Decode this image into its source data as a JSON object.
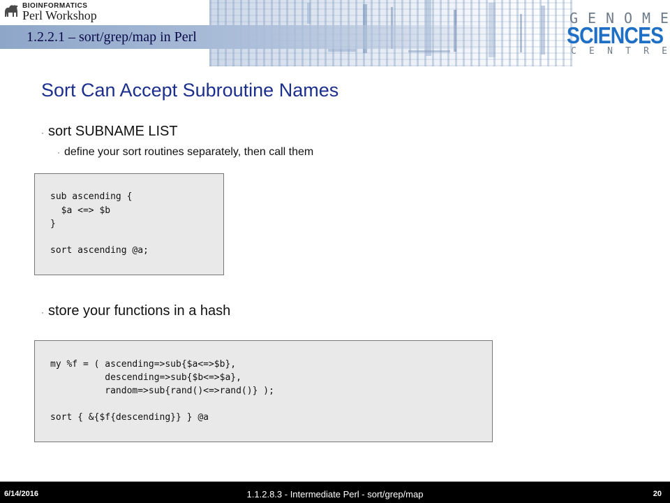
{
  "header": {
    "logo_small": "BIOINFORMATICS",
    "logo_big": "Perl Workshop",
    "lecture_title": "1.2.2.1 – sort/grep/map in Perl",
    "genome_letters": [
      "G",
      "E",
      "N",
      "O",
      "M",
      "E"
    ],
    "sciences": "SCIENCES",
    "centre_letters": [
      "C",
      "E",
      "N",
      "T",
      "R",
      "E"
    ]
  },
  "slide": {
    "title": "Sort Can Accept Subroutine Names",
    "bullet1": "sort SUBNAME LIST",
    "bullet2": "define your sort routines separately, then call them",
    "code1": [
      "sub ascending {",
      "  $a <=> $b",
      "}",
      "",
      "sort ascending @a;"
    ],
    "bullet3": "store your functions in a hash",
    "code2": [
      "my %f = ( ascending=>sub{$a<=>$b},",
      "          descending=>sub{$b<=>$a},",
      "          random=>sub{rand()<=>rand()} );",
      "",
      "sort { &{$f{descending}} } @a"
    ]
  },
  "footer": {
    "date": "6/14/2016",
    "center": "1.1.2.8.3 - Intermediate Perl - sort/grep/map",
    "page": "20"
  },
  "colors": {
    "title": "#1c2f8c",
    "sciences": "#1f6fc4",
    "footer_bg": "#000000",
    "code_bg": "#e9e9e9"
  }
}
